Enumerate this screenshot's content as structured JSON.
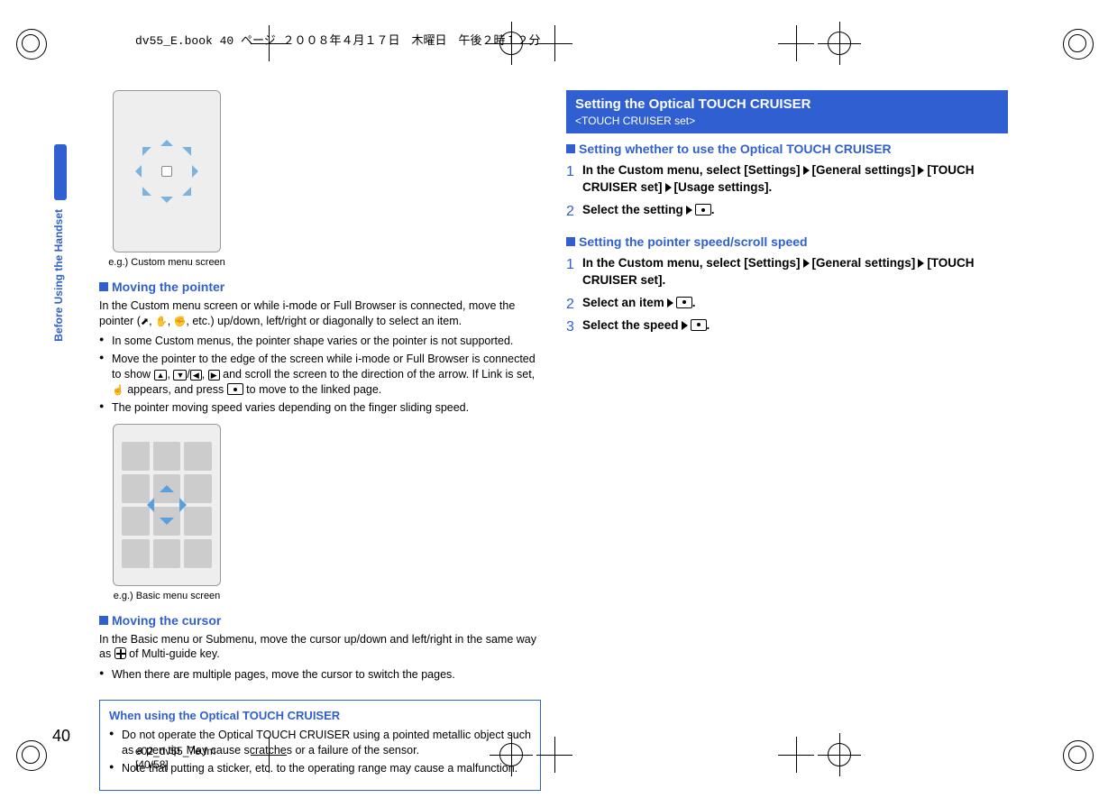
{
  "running_head": "dv55_E.book  40 ページ  ２００８年４月１７日　木曜日　午後２時１２分",
  "side_label": "Before Using the Handset",
  "page_number": "40",
  "footer": {
    "file": "e02_dv55_7e.fm",
    "pos": "[40/58]"
  },
  "left": {
    "h1": "Moving the pointer",
    "p1a": "In the Custom menu screen or while i-mode or Full Browser is connected, move the pointer (",
    "p1b": ", etc.) up/down, left/right or diagonally to select an item.",
    "b1": "In some Custom menus, the pointer shape varies or the pointer is not supported.",
    "b2a": "Move the pointer to the edge of the screen while i-mode or Full Browser is connected to show ",
    "b2b": " and scroll the screen to the direction of the arrow. If Link is set, ",
    "b2c": " appears, and press ",
    "b2d": " to move to the linked page.",
    "b3": "The pointer moving speed varies depending on the finger sliding speed.",
    "fig1_caption": "e.g.) Custom menu screen",
    "h2": "Moving the cursor",
    "p2a": "In the Basic menu or Submenu, move the cursor up/down and left/right in the same way as ",
    "p2b": " of Multi-guide key.",
    "b4": "When there are multiple pages, move the cursor to switch the pages.",
    "fig2_caption": "e.g.) Basic menu screen",
    "warn_title": "When using the Optical TOUCH CRUISER",
    "warn_b1": "Do not operate the Optical TOUCH CRUISER using a pointed metallic object such as a pen tip. May cause scratches or a failure of the sensor.",
    "warn_b2": "Note that putting a sticker, etc. to the operating range may cause a malfunction."
  },
  "right": {
    "banner_title": "Setting the Optical TOUCH CRUISER",
    "banner_sub": "<TOUCH CRUISER set>",
    "h3": "Setting whether to use the Optical TOUCH CRUISER",
    "steps1": [
      {
        "n": "1",
        "pre": "In the Custom menu, select [Settings]",
        "mid1": "[General settings]",
        "mid2": "[TOUCH CRUISER set]",
        "end": "[Usage settings]."
      },
      {
        "n": "2",
        "pre": "Select the setting",
        "end": "."
      }
    ],
    "h4": "Setting the pointer speed/scroll speed",
    "steps2": [
      {
        "n": "1",
        "pre": "In the Custom menu, select [Settings]",
        "mid1": "[General settings]",
        "end": "[TOUCH CRUISER set]."
      },
      {
        "n": "2",
        "pre": "Select an item",
        "end": "."
      },
      {
        "n": "3",
        "pre": "Select the speed",
        "end": "."
      }
    ]
  }
}
